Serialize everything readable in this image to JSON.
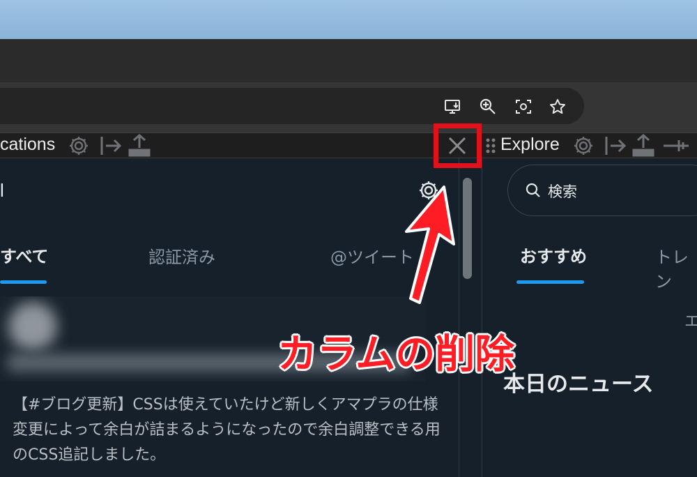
{
  "browser": {
    "omnibox_icons": [
      "install-app-icon",
      "zoom-in-icon",
      "screenshot-icon",
      "bookmark-star-icon"
    ]
  },
  "columns": {
    "left": {
      "header_title": "cations",
      "title_fragment": "l",
      "tabs": [
        {
          "label": "すべて",
          "active": true
        },
        {
          "label": "認証済み",
          "active": false
        },
        {
          "label": "@ツイート",
          "active": false
        }
      ],
      "tweet_text": "【#ブログ更新】CSSは使えていたけど新しくアマプラの仕様変更によって余白が詰まるようになったので余白調整できる用のCSS追記しました。"
    },
    "right": {
      "header_title": "Explore",
      "search_placeholder": "検索",
      "tabs": [
        {
          "label": "おすすめ",
          "active": true
        },
        {
          "label": "トレン",
          "active": false
        }
      ],
      "fragment_e": "エ",
      "news_heading": "本日のニュース"
    }
  },
  "annotation": {
    "label": "カラムの削除",
    "color": "#ff1d25"
  },
  "colors": {
    "background": "#15202b",
    "accent": "#1d9bf0",
    "annotation_red": "#e0111a"
  }
}
